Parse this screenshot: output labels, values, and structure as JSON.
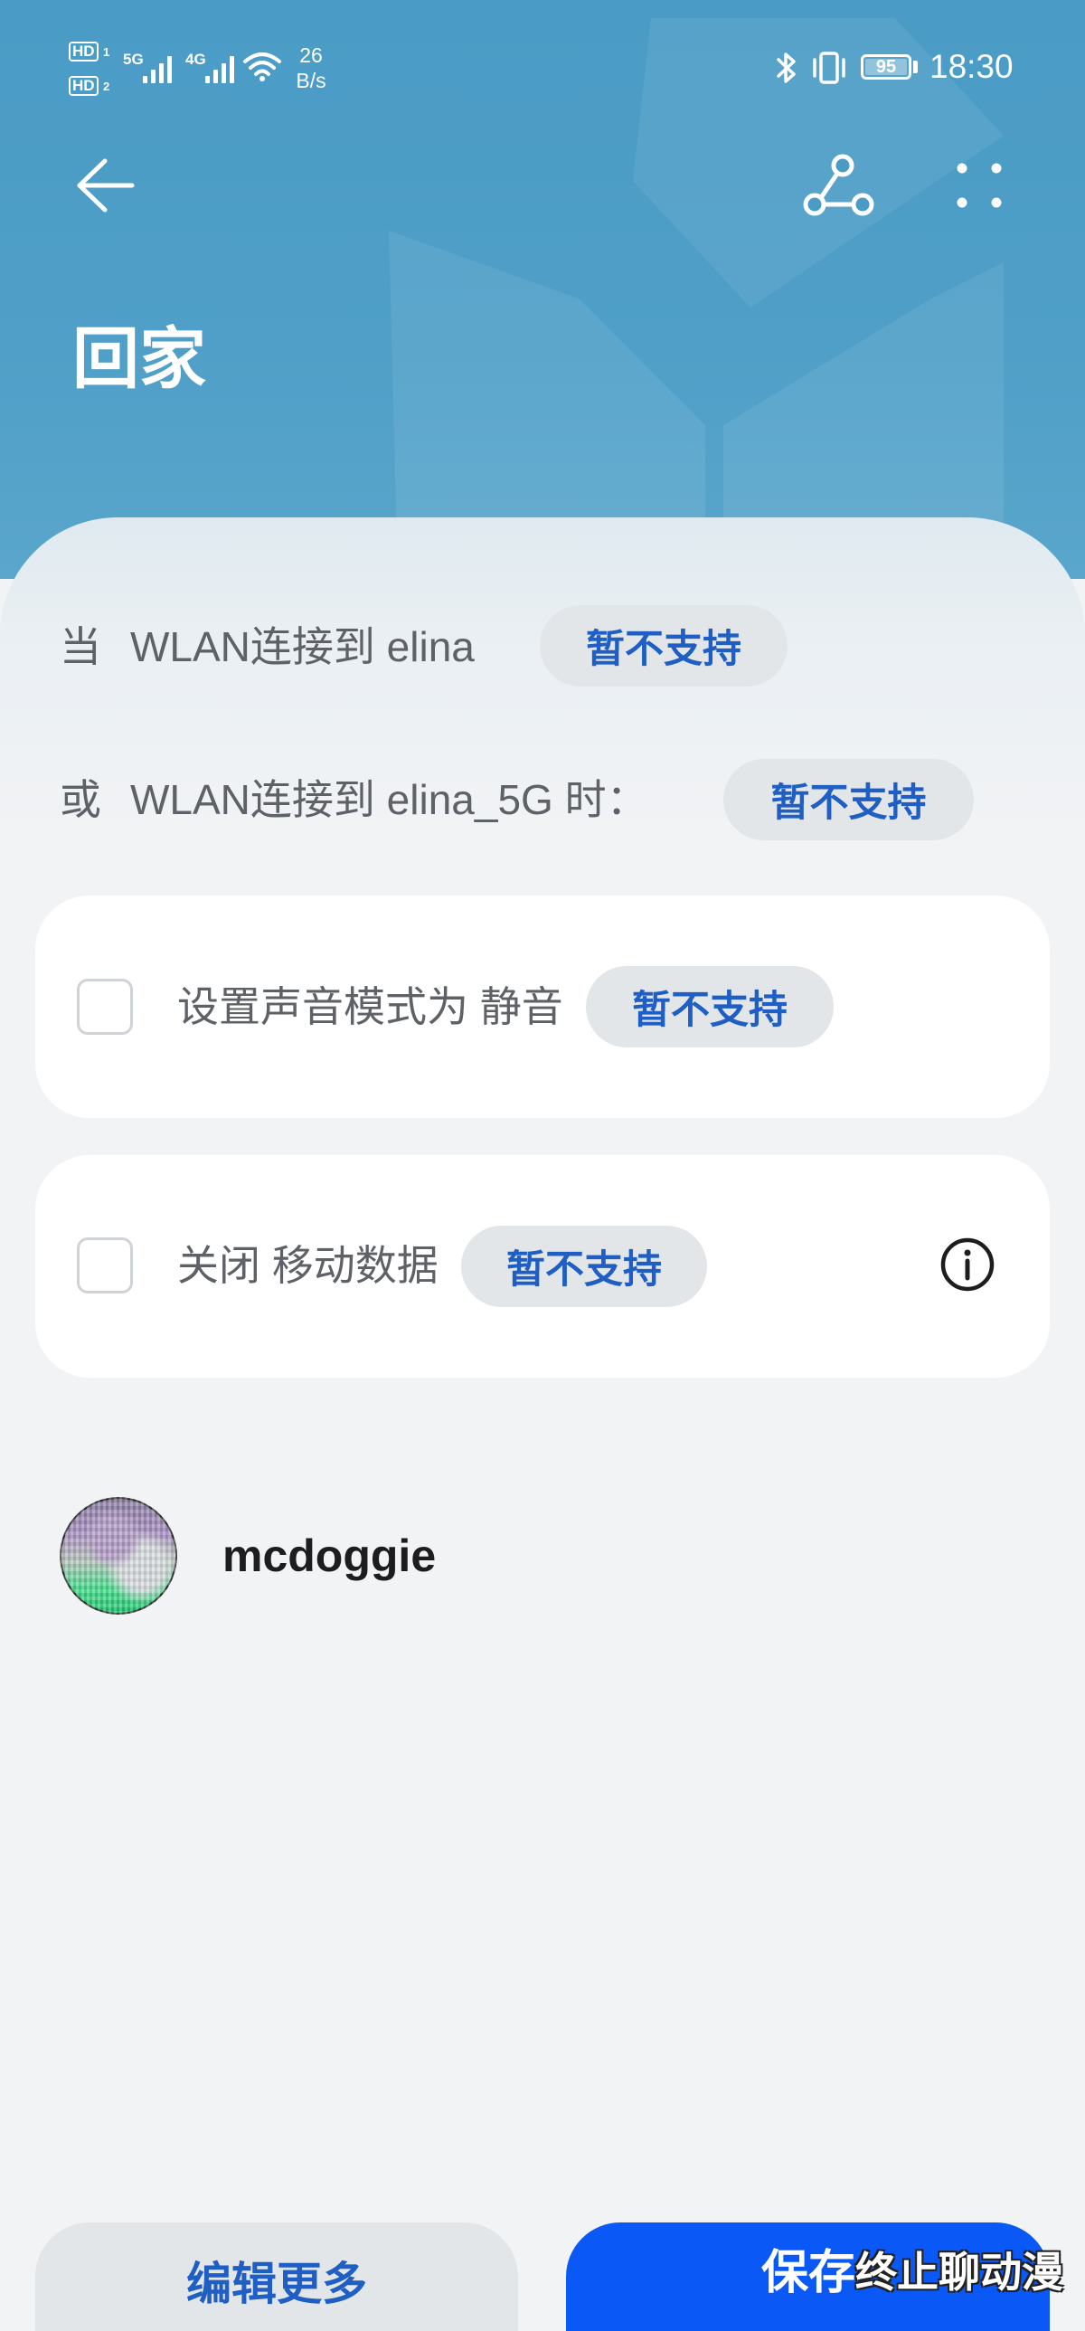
{
  "status_bar": {
    "hd1": "HD",
    "sim1": "1",
    "hd2": "HD",
    "sim2": "2",
    "net1": "5G",
    "net2": "4G",
    "speed_value": "26",
    "speed_unit": "B/s",
    "battery": "95",
    "time": "18:30"
  },
  "header": {
    "title": "回家",
    "icons": [
      "back-arrow-icon",
      "share-nodes-icon",
      "more-dots-icon"
    ]
  },
  "conditions": [
    {
      "prefix": "当",
      "text": "WLAN连接到 elina",
      "pill": "暂不支持"
    },
    {
      "prefix": "或",
      "text": "WLAN连接到 elina_5G 时：",
      "pill": "暂不支持"
    }
  ],
  "actions": [
    {
      "label": "设置声音模式为 静音",
      "pill": "暂不支持",
      "checked": false
    },
    {
      "label": "关闭 移动数据",
      "pill": "暂不支持",
      "checked": false,
      "icon": "info-icon"
    }
  ],
  "user": {
    "name": "mcdoggie"
  },
  "footer": {
    "edit_label": "编辑更多",
    "save_label": "保存"
  },
  "watermark": "终止聊动漫",
  "colors": {
    "header_bg": "#4a9bc5",
    "sheet_bg": "#f1f3f5",
    "pill_bg": "#e3e6e9",
    "pill_text": "#1f5fc4",
    "primary_button": "#0a59f7"
  }
}
